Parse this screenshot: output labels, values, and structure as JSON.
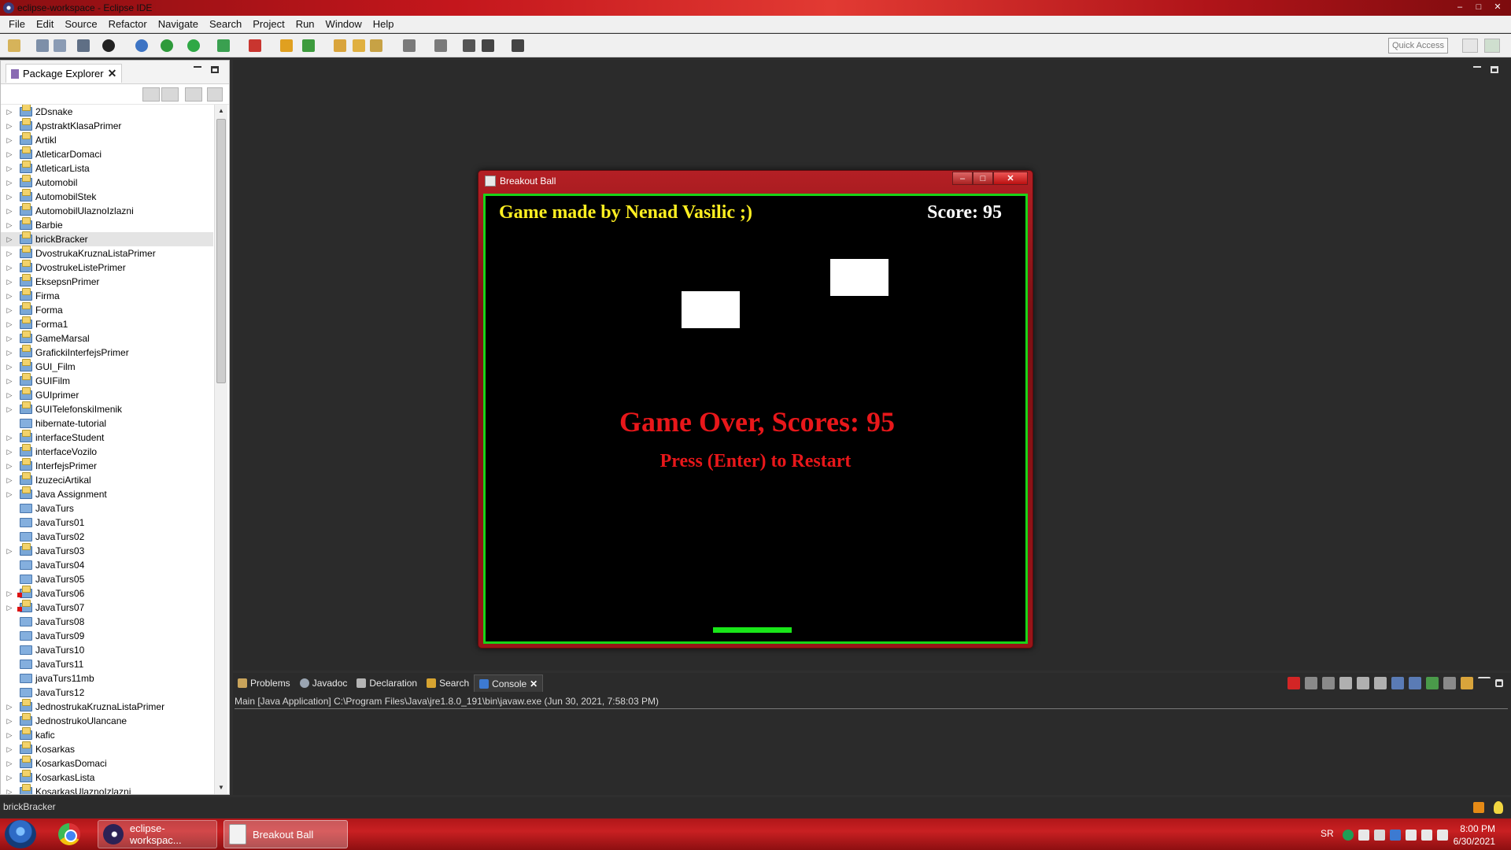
{
  "window": {
    "title": "eclipse-workspace - Eclipse IDE",
    "min": "–",
    "max": "□",
    "close": "✕"
  },
  "menu": [
    "File",
    "Edit",
    "Source",
    "Refactor",
    "Navigate",
    "Search",
    "Project",
    "Run",
    "Window",
    "Help"
  ],
  "toolbar": {
    "quick_access_placeholder": "Quick Access"
  },
  "explorer": {
    "tab_label": "Package Explorer",
    "selected": "brickBracker",
    "items": [
      {
        "label": "2Dsnake",
        "type": "proj"
      },
      {
        "label": "ApstraktKlasaPrimer",
        "type": "proj"
      },
      {
        "label": "Artikl",
        "type": "proj"
      },
      {
        "label": "AtleticarDomaci",
        "type": "proj"
      },
      {
        "label": "AtleticarLista",
        "type": "proj"
      },
      {
        "label": "Automobil",
        "type": "proj"
      },
      {
        "label": "AutomobilStek",
        "type": "proj"
      },
      {
        "label": "AutomobilUlaznoIzlazni",
        "type": "proj"
      },
      {
        "label": "Barbie",
        "type": "proj"
      },
      {
        "label": "brickBracker",
        "type": "proj"
      },
      {
        "label": "DvostrukaKruznaListaPrimer",
        "type": "proj"
      },
      {
        "label": "DvostrukeListePrimer",
        "type": "proj"
      },
      {
        "label": "EksepsnPrimer",
        "type": "proj"
      },
      {
        "label": "Firma",
        "type": "proj"
      },
      {
        "label": "Forma",
        "type": "proj"
      },
      {
        "label": "Forma1",
        "type": "proj"
      },
      {
        "label": "GameMarsal",
        "type": "proj"
      },
      {
        "label": "GrafickiInterfejsPrimer",
        "type": "proj"
      },
      {
        "label": "GUI_Film",
        "type": "proj"
      },
      {
        "label": "GUIFilm",
        "type": "proj"
      },
      {
        "label": "GUIprimer",
        "type": "proj"
      },
      {
        "label": "GUITelefonskiImenik",
        "type": "proj"
      },
      {
        "label": "hibernate-tutorial",
        "type": "plain"
      },
      {
        "label": "interfaceStudent",
        "type": "proj"
      },
      {
        "label": "interfaceVozilo",
        "type": "proj"
      },
      {
        "label": "InterfejsPrimer",
        "type": "proj"
      },
      {
        "label": "IzuzeciArtikal",
        "type": "proj"
      },
      {
        "label": "Java Assignment",
        "type": "proj"
      },
      {
        "label": "JavaTurs",
        "type": "plain"
      },
      {
        "label": "JavaTurs01",
        "type": "plain"
      },
      {
        "label": "JavaTurs02",
        "type": "plain"
      },
      {
        "label": "JavaTurs03",
        "type": "proj"
      },
      {
        "label": "JavaTurs04",
        "type": "plain"
      },
      {
        "label": "JavaTurs05",
        "type": "plain"
      },
      {
        "label": "JavaTurs06",
        "type": "err"
      },
      {
        "label": "JavaTurs07",
        "type": "err"
      },
      {
        "label": "JavaTurs08",
        "type": "plain"
      },
      {
        "label": "JavaTurs09",
        "type": "plain"
      },
      {
        "label": "JavaTurs10",
        "type": "plain"
      },
      {
        "label": "JavaTurs11",
        "type": "plain"
      },
      {
        "label": "javaTurs11mb",
        "type": "plain"
      },
      {
        "label": "JavaTurs12",
        "type": "plain"
      },
      {
        "label": "JednostrukaKruznaListaPrimer",
        "type": "proj"
      },
      {
        "label": "JednostrukoUlancane",
        "type": "proj"
      },
      {
        "label": "kafic",
        "type": "proj"
      },
      {
        "label": "Kosarkas",
        "type": "proj"
      },
      {
        "label": "KosarkasDomaci",
        "type": "proj"
      },
      {
        "label": "KosarkasLista",
        "type": "proj"
      },
      {
        "label": "KosarkasUlaznoIzlazni",
        "type": "proj"
      }
    ]
  },
  "game": {
    "window_title": "Breakout Ball",
    "credit": "Game made by Nenad Vasilic ;)",
    "score": "Score: 95",
    "game_over": "Game Over, Scores: 95",
    "restart": "Press (Enter) to Restart",
    "colors": {
      "credit": "#ffef21",
      "game_over": "#e8171a",
      "paddle": "#19e619",
      "border": "#19d419"
    }
  },
  "console": {
    "tabs": [
      {
        "label": "Problems",
        "icon": "problems-icon"
      },
      {
        "label": "Javadoc",
        "icon": "javadoc-icon"
      },
      {
        "label": "Declaration",
        "icon": "declaration-icon"
      },
      {
        "label": "Search",
        "icon": "search-icon"
      },
      {
        "label": "Console",
        "icon": "console-icon",
        "active": true
      }
    ],
    "process": "Main [Java Application] C:\\Program Files\\Java\\jre1.8.0_191\\bin\\javaw.exe (Jun 30, 2021, 7:58:03 PM)"
  },
  "status": {
    "text": "brickBracker"
  },
  "taskbar": {
    "apps": [
      "eclipse-workspac...",
      "Breakout Ball"
    ],
    "lang": "SR",
    "time": "8:00 PM",
    "date": "6/30/2021"
  }
}
